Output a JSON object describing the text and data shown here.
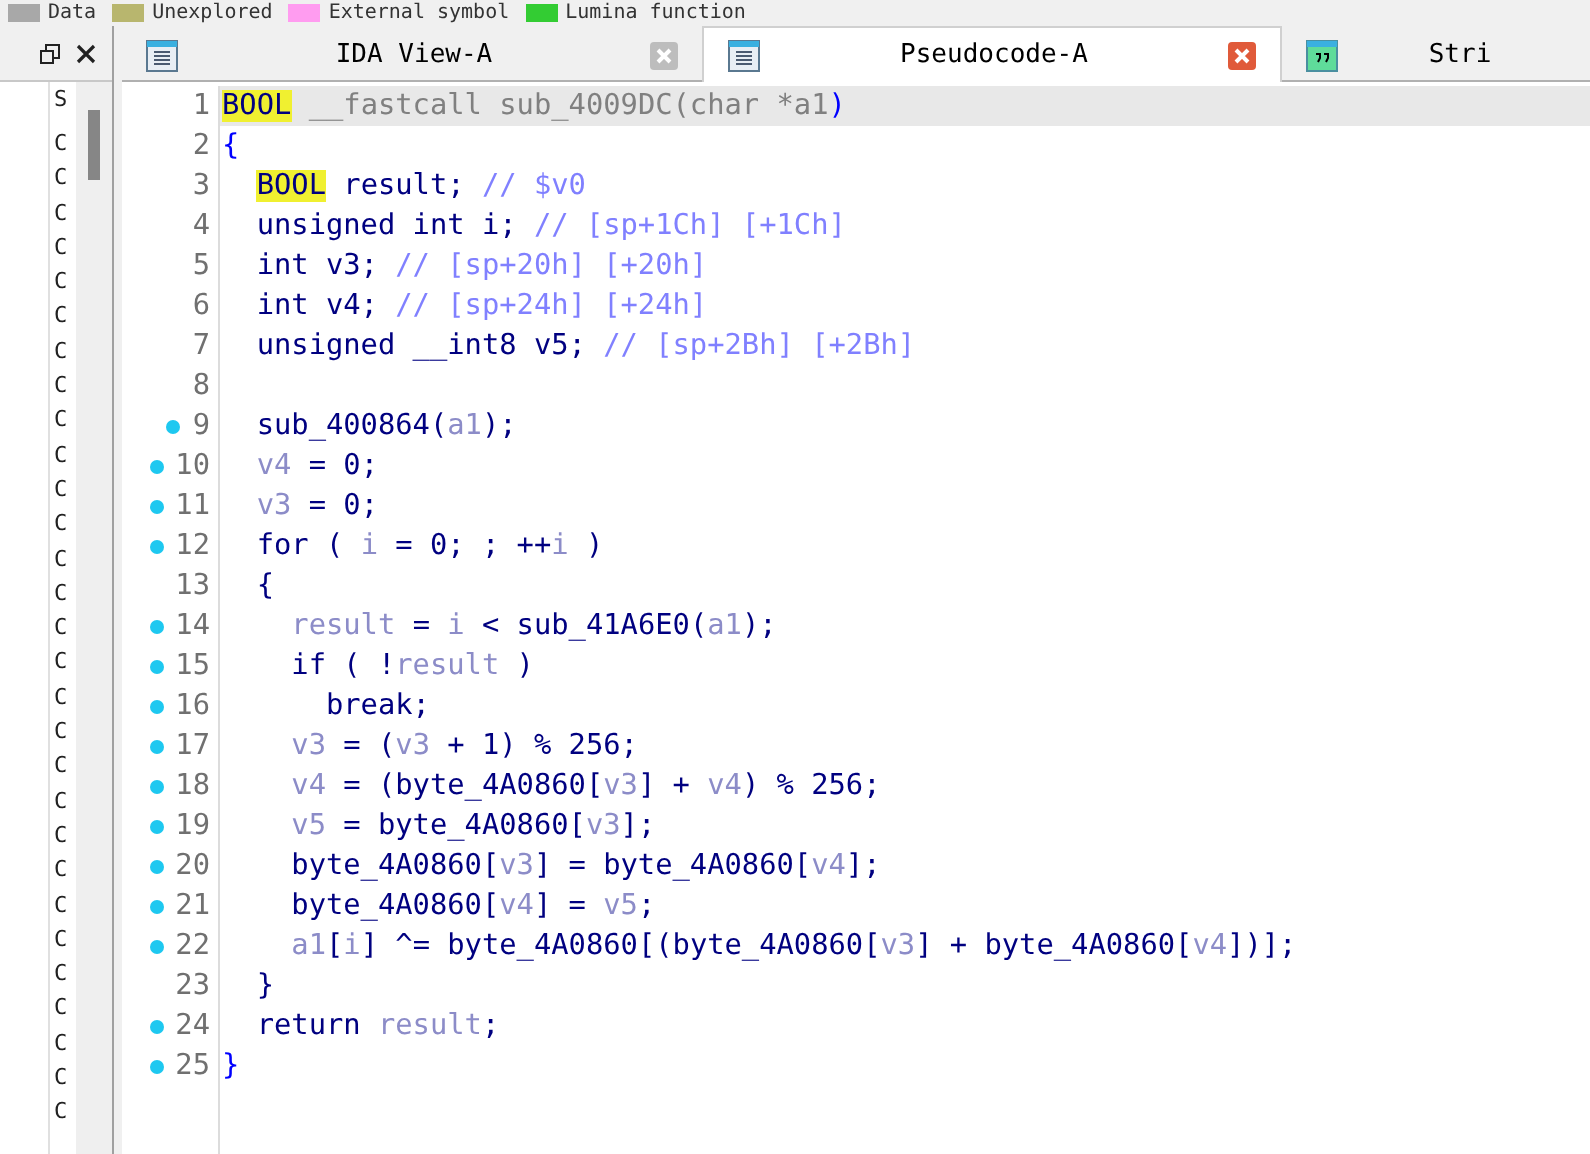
{
  "legend": [
    {
      "label": "Data",
      "color": "#a8a8a8"
    },
    {
      "label": "Unexplored",
      "color": "#b8b66e"
    },
    {
      "label": "External symbol",
      "color": "#ff9cf0"
    },
    {
      "label": "Lumina function",
      "color": "#33cc33"
    }
  ],
  "side_panel": {
    "column_header": "S",
    "rows": [
      "C",
      "C",
      "C",
      "C",
      "C",
      "C",
      "C",
      "C",
      "C",
      "C",
      "C",
      "C",
      "C",
      "C",
      "C",
      "C",
      "C",
      "C",
      "C",
      "C",
      "C",
      "C",
      "C",
      "C",
      "C",
      "C",
      "C",
      "C",
      "C"
    ]
  },
  "tabs": [
    {
      "label": "IDA View-A",
      "kind": "disasm",
      "selected": false
    },
    {
      "label": "Pseudocode-A",
      "kind": "pseudo",
      "selected": true
    },
    {
      "label": "Stri",
      "kind": "strings",
      "selected": false
    }
  ],
  "code": [
    {
      "number": "1",
      "breakpoint": false,
      "current": true,
      "tokens": [
        {
          "kind": "type",
          "text": "BOOL"
        },
        {
          "kind": "dim",
          "text": " __fastcall sub_4009DC(char *a1"
        },
        {
          "kind": "paren",
          "text": ")"
        }
      ]
    },
    {
      "number": "2",
      "breakpoint": false,
      "current": false,
      "tokens": [
        {
          "kind": "paren",
          "text": "{"
        }
      ]
    },
    {
      "number": "3",
      "breakpoint": false,
      "current": false,
      "tokens": [
        {
          "kind": "type",
          "text": "  BOOL"
        },
        {
          "kind": "plain",
          "text": " result; "
        },
        {
          "kind": "comment",
          "text": "// $v0"
        }
      ]
    },
    {
      "number": "4",
      "breakpoint": false,
      "current": false,
      "tokens": [
        {
          "kind": "plain",
          "text": "  unsigned int i; "
        },
        {
          "kind": "comment",
          "text": "// [sp+1Ch] [+1Ch]"
        }
      ]
    },
    {
      "number": "5",
      "breakpoint": false,
      "current": false,
      "tokens": [
        {
          "kind": "plain",
          "text": "  int v3; "
        },
        {
          "kind": "comment",
          "text": "// [sp+20h] [+20h]"
        }
      ]
    },
    {
      "number": "6",
      "breakpoint": false,
      "current": false,
      "tokens": [
        {
          "kind": "plain",
          "text": "  int v4; "
        },
        {
          "kind": "comment",
          "text": "// [sp+24h] [+24h]"
        }
      ]
    },
    {
      "number": "7",
      "breakpoint": false,
      "current": false,
      "tokens": [
        {
          "kind": "plain",
          "text": "  unsigned __int8 v5; "
        },
        {
          "kind": "comment",
          "text": "// [sp+2Bh] [+2Bh]"
        }
      ]
    },
    {
      "number": "8",
      "breakpoint": false,
      "current": false
    },
    {
      "number": "9",
      "breakpoint": true,
      "current": false,
      "tokens": [
        {
          "kind": "plain",
          "text": "  sub_400864("
        },
        {
          "kind": "var",
          "text": "a1"
        },
        {
          "kind": "plain",
          "text": ");"
        }
      ]
    },
    {
      "number": "10",
      "breakpoint": true,
      "current": false,
      "tokens": [
        {
          "kind": "var",
          "text": "  v4"
        },
        {
          "kind": "plain",
          "text": " = 0;"
        }
      ]
    },
    {
      "number": "11",
      "breakpoint": true,
      "current": false,
      "tokens": [
        {
          "kind": "var",
          "text": "  v3"
        },
        {
          "kind": "plain",
          "text": " = 0;"
        }
      ]
    },
    {
      "number": "12",
      "breakpoint": true,
      "current": false,
      "tokens": [
        {
          "kind": "plain",
          "text": "  for ( "
        },
        {
          "kind": "var",
          "text": "i"
        },
        {
          "kind": "plain",
          "text": " = 0; ; ++"
        },
        {
          "kind": "var",
          "text": "i"
        },
        {
          "kind": "plain",
          "text": " )"
        }
      ]
    },
    {
      "number": "13",
      "breakpoint": false,
      "current": false,
      "tokens": [
        {
          "kind": "plain",
          "text": "  {"
        }
      ]
    },
    {
      "number": "14",
      "breakpoint": true,
      "current": false,
      "tokens": [
        {
          "kind": "var",
          "text": "    result"
        },
        {
          "kind": "plain",
          "text": " = "
        },
        {
          "kind": "var",
          "text": "i"
        },
        {
          "kind": "plain",
          "text": " < sub_41A6E0("
        },
        {
          "kind": "var",
          "text": "a1"
        },
        {
          "kind": "plain",
          "text": ");"
        }
      ]
    },
    {
      "number": "15",
      "breakpoint": true,
      "current": false,
      "tokens": [
        {
          "kind": "plain",
          "text": "    if ( !"
        },
        {
          "kind": "var",
          "text": "result"
        },
        {
          "kind": "plain",
          "text": " )"
        }
      ]
    },
    {
      "number": "16",
      "breakpoint": true,
      "current": false,
      "tokens": [
        {
          "kind": "plain",
          "text": "      break;"
        }
      ]
    },
    {
      "number": "17",
      "breakpoint": true,
      "current": false,
      "tokens": [
        {
          "kind": "var",
          "text": "    v3"
        },
        {
          "kind": "plain",
          "text": " = ("
        },
        {
          "kind": "var",
          "text": "v3"
        },
        {
          "kind": "plain",
          "text": " + 1) % 256;"
        }
      ]
    },
    {
      "number": "18",
      "breakpoint": true,
      "current": false,
      "tokens": [
        {
          "kind": "var",
          "text": "    v4"
        },
        {
          "kind": "plain",
          "text": " = (byte_4A0860["
        },
        {
          "kind": "var",
          "text": "v3"
        },
        {
          "kind": "plain",
          "text": "] + "
        },
        {
          "kind": "var",
          "text": "v4"
        },
        {
          "kind": "plain",
          "text": ") % 256;"
        }
      ]
    },
    {
      "number": "19",
      "breakpoint": true,
      "current": false,
      "tokens": [
        {
          "kind": "var",
          "text": "    v5"
        },
        {
          "kind": "plain",
          "text": " = byte_4A0860["
        },
        {
          "kind": "var",
          "text": "v3"
        },
        {
          "kind": "plain",
          "text": "];"
        }
      ]
    },
    {
      "number": "20",
      "breakpoint": true,
      "current": false,
      "tokens": [
        {
          "kind": "plain",
          "text": "    byte_4A0860["
        },
        {
          "kind": "var",
          "text": "v3"
        },
        {
          "kind": "plain",
          "text": "] = byte_4A0860["
        },
        {
          "kind": "var",
          "text": "v4"
        },
        {
          "kind": "plain",
          "text": "];"
        }
      ]
    },
    {
      "number": "21",
      "breakpoint": true,
      "current": false,
      "tokens": [
        {
          "kind": "plain",
          "text": "    byte_4A0860["
        },
        {
          "kind": "var",
          "text": "v4"
        },
        {
          "kind": "plain",
          "text": "] = "
        },
        {
          "kind": "var",
          "text": "v5"
        },
        {
          "kind": "plain",
          "text": ";"
        }
      ]
    },
    {
      "number": "22",
      "breakpoint": true,
      "current": false,
      "tokens": [
        {
          "kind": "var",
          "text": "    a1"
        },
        {
          "kind": "plain",
          "text": "["
        },
        {
          "kind": "var",
          "text": "i"
        },
        {
          "kind": "plain",
          "text": "] ^= byte_4A0860[(byte_4A0860["
        },
        {
          "kind": "var",
          "text": "v3"
        },
        {
          "kind": "plain",
          "text": "] + byte_4A0860["
        },
        {
          "kind": "var",
          "text": "v4"
        },
        {
          "kind": "plain",
          "text": "])];"
        }
      ]
    },
    {
      "number": "23",
      "breakpoint": false,
      "current": false,
      "tokens": [
        {
          "kind": "plain",
          "text": "  }"
        }
      ]
    },
    {
      "number": "24",
      "breakpoint": true,
      "current": false,
      "tokens": [
        {
          "kind": "plain",
          "text": "  return "
        },
        {
          "kind": "var",
          "text": "result"
        },
        {
          "kind": "plain",
          "text": ";"
        }
      ]
    },
    {
      "number": "25",
      "breakpoint": true,
      "current": false,
      "tokens": [
        {
          "kind": "paren",
          "text": "}"
        }
      ]
    }
  ]
}
